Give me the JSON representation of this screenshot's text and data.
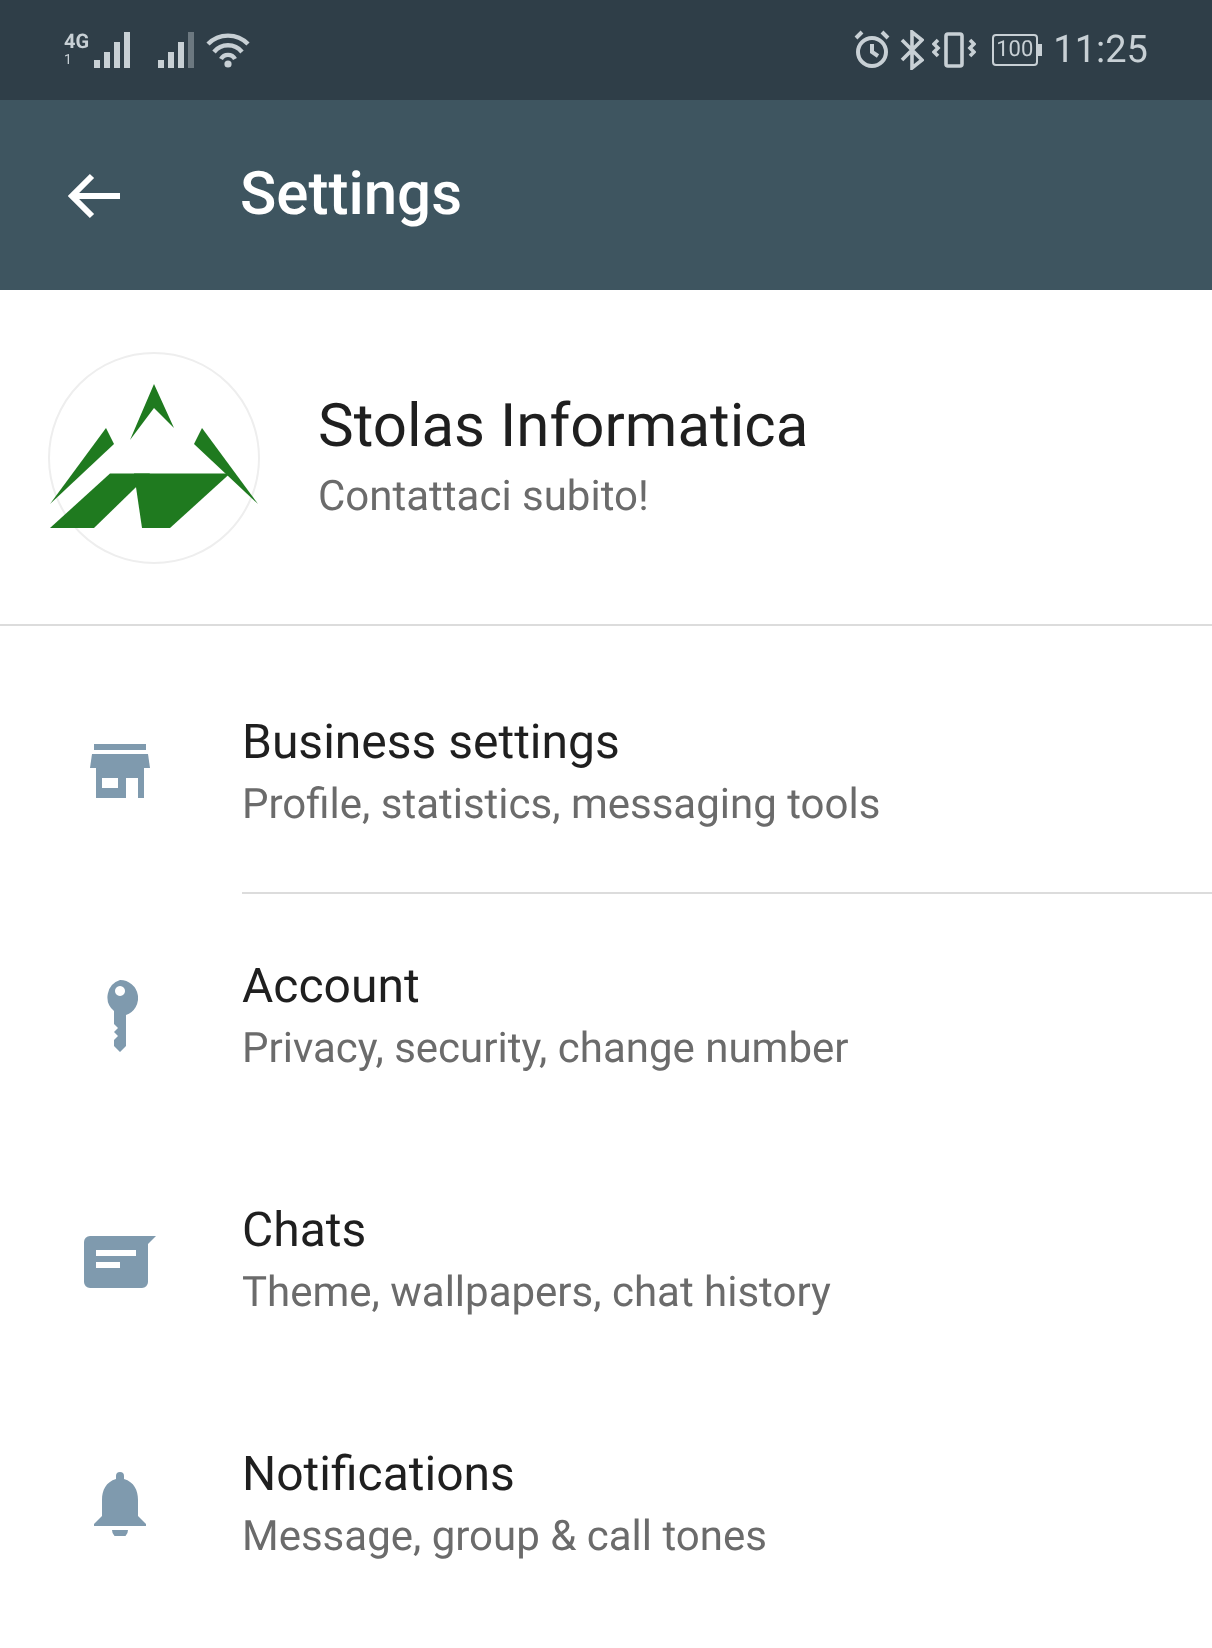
{
  "status_bar": {
    "network": "4G",
    "sim_slot": "1",
    "battery": "100",
    "time": "11:25"
  },
  "header": {
    "title": "Settings"
  },
  "profile": {
    "name": "Stolas Informatica",
    "status": "Contattaci subito!"
  },
  "items": [
    {
      "kind": "store",
      "title": "Business settings",
      "subtitle": "Profile, statistics, messaging tools",
      "divider_below": true
    },
    {
      "kind": "key",
      "title": "Account",
      "subtitle": "Privacy, security, change number",
      "divider_below": false
    },
    {
      "kind": "chat",
      "title": "Chats",
      "subtitle": "Theme, wallpapers, chat history",
      "divider_below": false
    },
    {
      "kind": "bell",
      "title": "Notifications",
      "subtitle": "Message, group & call tones",
      "divider_below": false
    }
  ]
}
